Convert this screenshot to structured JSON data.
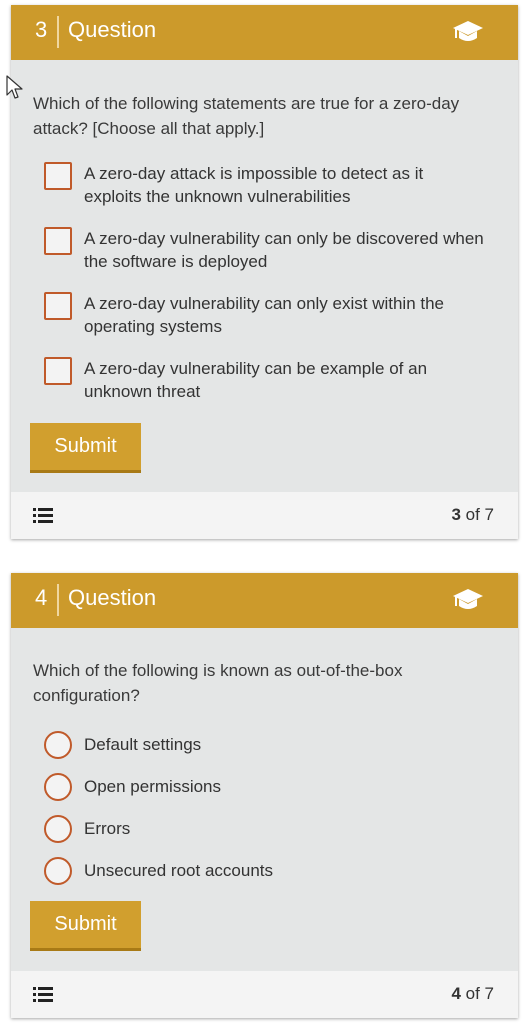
{
  "cards": [
    {
      "number": "3",
      "header_label": "Question",
      "question": "Which of the following statements are true for a zero-day attack? [Choose all that apply.]",
      "input_type": "checkbox",
      "options": [
        "A zero-day attack is impossible to detect as it exploits the unknown vulnerabilities",
        "A zero-day vulnerability can only be discovered when the software is deployed",
        "A zero-day vulnerability can only exist within the operating systems",
        "A zero-day vulnerability can be example of an unknown threat"
      ],
      "submit_label": "Submit",
      "progress_current": "3",
      "progress_suffix": "of 7"
    },
    {
      "number": "4",
      "header_label": "Question",
      "question": "Which of the following is known as out-of-the-box configuration?",
      "input_type": "radio",
      "options": [
        "Default settings",
        "Open permissions",
        "Errors",
        "Unsecured root accounts"
      ],
      "submit_label": "Submit",
      "progress_current": "4",
      "progress_suffix": "of 7"
    }
  ],
  "icons": {
    "header": "graduation-cap-icon",
    "footer": "list-icon",
    "pointer": "mouse-cursor-icon"
  },
  "colors": {
    "header": "#cc9a2b",
    "button": "#d19f2e",
    "card_bg": "#e4e6e6",
    "footer_bg": "#f4f4f4",
    "input_border": "#c05a2a"
  }
}
